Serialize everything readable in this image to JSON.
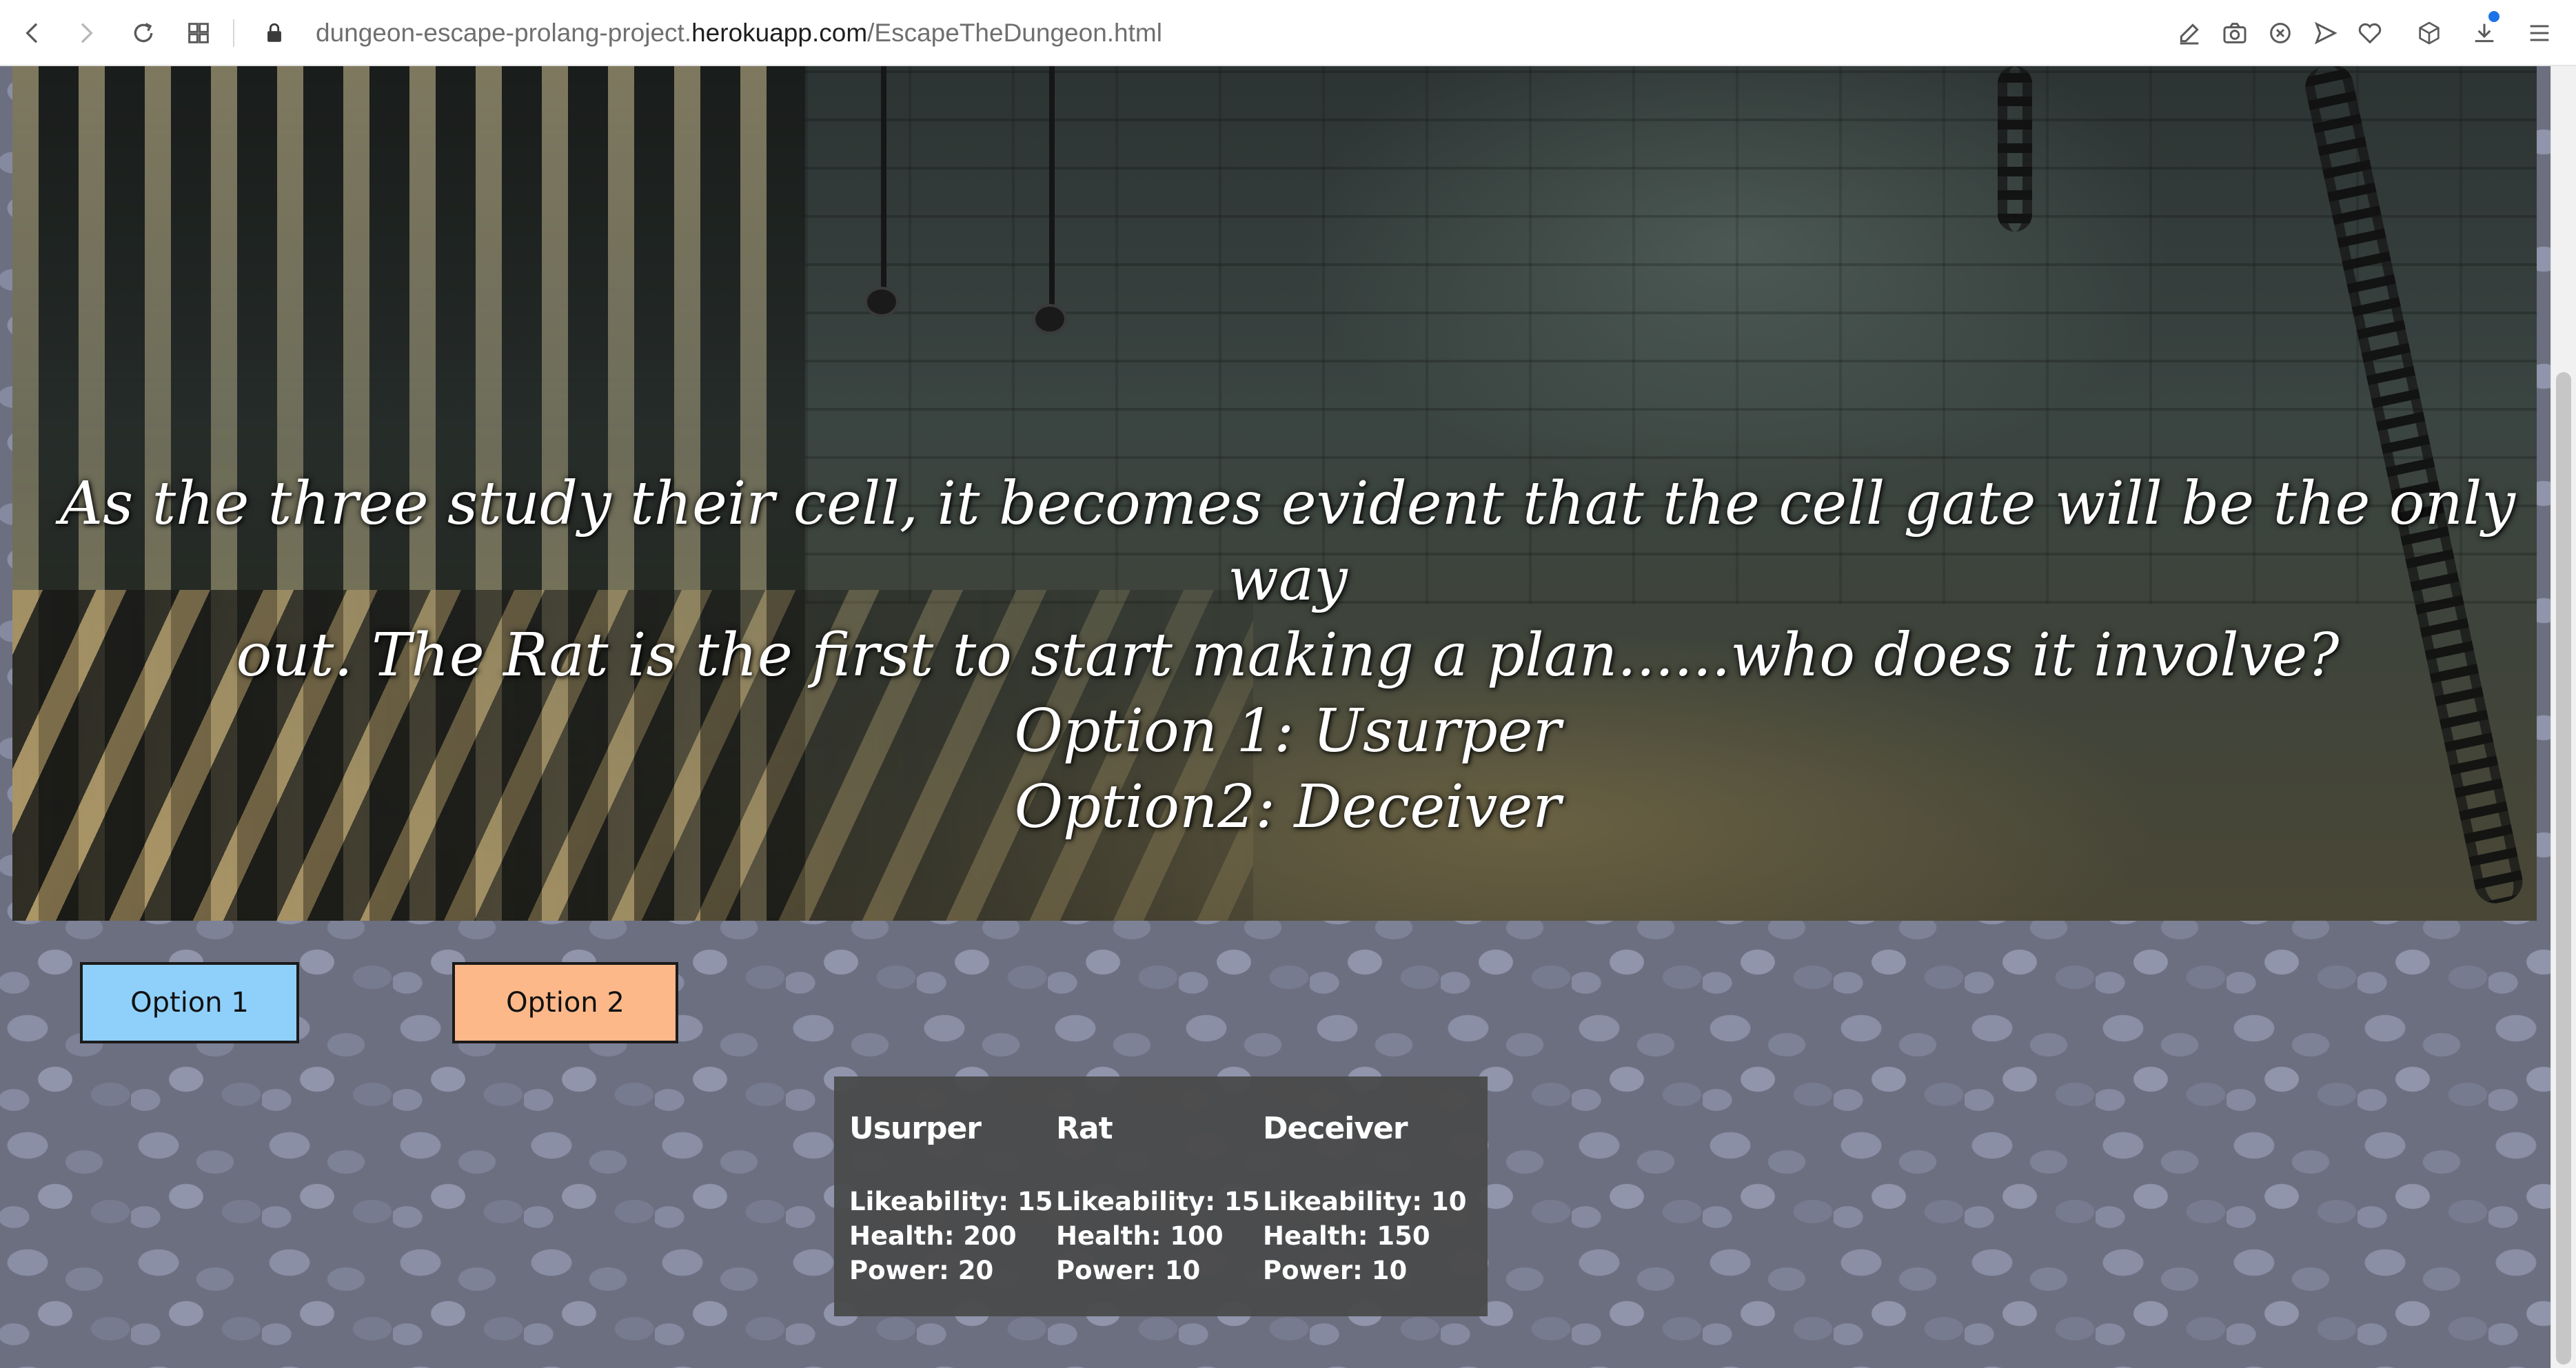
{
  "browser": {
    "url_scheme_part": "dungeon-escape-prolang-project.",
    "url_host": "herokuapp.com",
    "url_path": "/EscapeTheDungeon.html"
  },
  "story": {
    "line1": "As the three study their cell, it becomes evident that the cell gate will be the only way",
    "line2": "out. The Rat is the first to start making a plan......who does it involve?",
    "line3": "Option 1: Usurper",
    "line4": "Option2: Deceiver"
  },
  "options": {
    "option1_label": "Option 1",
    "option2_label": "Option 2",
    "option1_color": "#8fd0fb",
    "option2_color": "#fcb889"
  },
  "characters": [
    {
      "name": "Usurper",
      "likeability": "Likeability: 15",
      "health": "Health: 200",
      "power": "Power: 20"
    },
    {
      "name": "Rat",
      "likeability": "Likeability: 15",
      "health": "Health: 100",
      "power": "Power: 10"
    },
    {
      "name": "Deceiver",
      "likeability": "Likeability: 10",
      "health": "Health: 150",
      "power": "Power: 10"
    }
  ]
}
